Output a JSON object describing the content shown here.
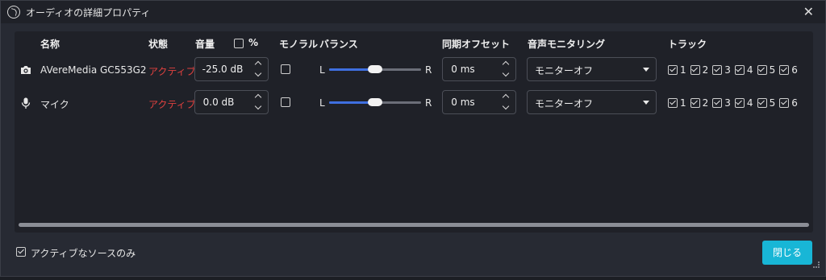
{
  "window": {
    "title": "オーディオの詳細プロパティ",
    "close_glyph": "✕"
  },
  "columns": {
    "name": "名称",
    "status": "状態",
    "volume": "音量",
    "percent": "%",
    "mono": "モノラル",
    "balance": "バランス",
    "sync_offset": "同期オフセット",
    "monitoring": "音声モニタリング",
    "tracks": "トラック"
  },
  "balance_labels": {
    "left": "L",
    "right": "R"
  },
  "rows": [
    {
      "icon": "camera-icon",
      "name": "AVereMedia GC553G2",
      "status": "アクティブ",
      "volume": "-25.0 dB",
      "mono": false,
      "balance": 0.5,
      "sync_offset": "0 ms",
      "monitoring": "モニターオフ",
      "tracks": [
        "1",
        "2",
        "3",
        "4",
        "5",
        "6"
      ]
    },
    {
      "icon": "microphone-icon",
      "name": "マイク",
      "status": "アクティブ",
      "volume": "0.0 dB",
      "mono": false,
      "balance": 0.5,
      "sync_offset": "0 ms",
      "monitoring": "モニターオフ",
      "tracks": [
        "1",
        "2",
        "3",
        "4",
        "5",
        "6"
      ]
    }
  ],
  "footer": {
    "active_only_label": "アクティブなソースのみ",
    "active_only_checked": true,
    "close_button": "閉じる"
  },
  "colors": {
    "status_active": "#e2413f",
    "accent": "#18b6d6",
    "slider_fill": "#3f6fe0"
  }
}
